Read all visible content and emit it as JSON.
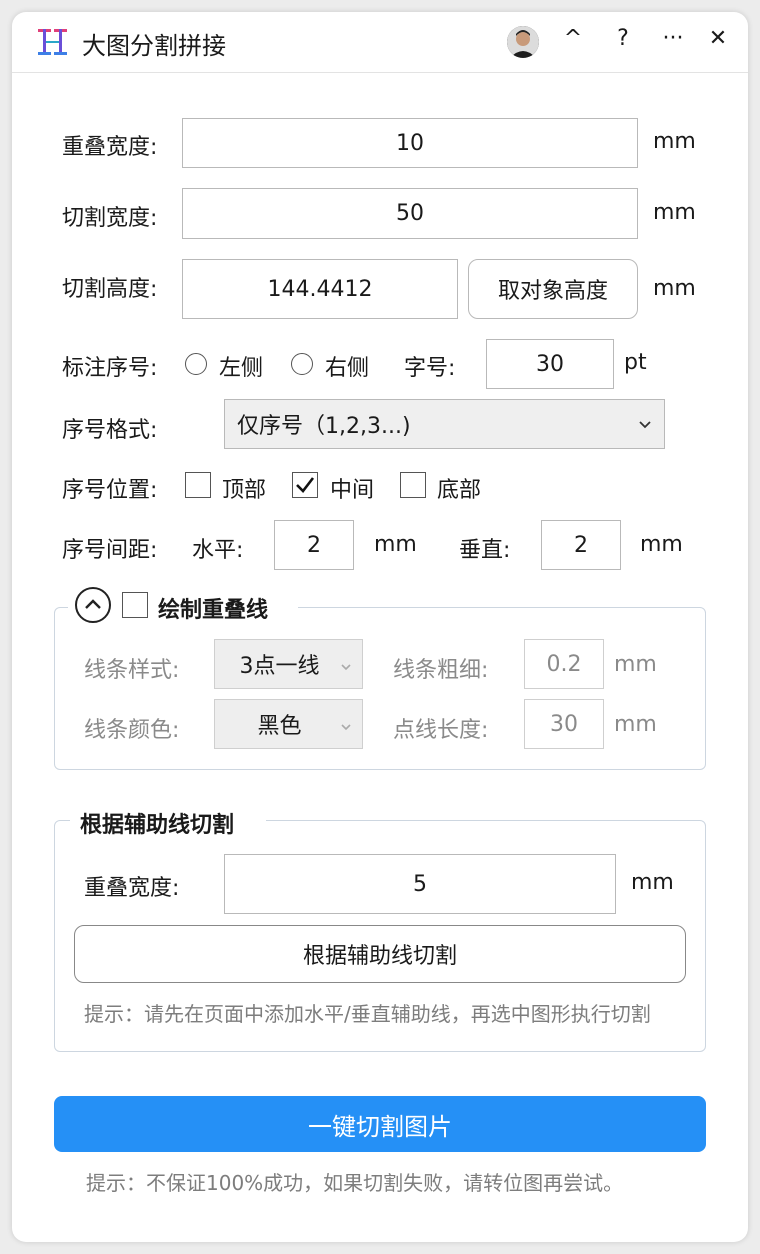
{
  "title": "大图分割拼接",
  "titlebar": {
    "collapse": "^",
    "help": "?",
    "more": "···",
    "close": "✕"
  },
  "overlap": {
    "label": "重叠宽度:",
    "value": "10",
    "unit": "mm"
  },
  "cut_width": {
    "label": "切割宽度:",
    "value": "50",
    "unit": "mm"
  },
  "cut_height": {
    "label": "切割高度:",
    "value": "144.4412",
    "button": "取对象高度",
    "unit": "mm"
  },
  "annot": {
    "label": "标注序号:",
    "left": "左侧",
    "right": "右侧",
    "font_label": "字号:",
    "font_value": "30",
    "font_unit": "pt"
  },
  "format": {
    "label": "序号格式:",
    "value": "仅序号（1,2,3...)"
  },
  "position": {
    "label": "序号位置:",
    "top": "顶部",
    "middle": "中间",
    "bottom": "底部",
    "middle_checked": true
  },
  "spacing": {
    "label": "序号间距:",
    "h_label": "水平:",
    "h_value": "2",
    "h_unit": "mm",
    "v_label": "垂直:",
    "v_value": "2",
    "v_unit": "mm"
  },
  "overlap_line": {
    "title": "绘制重叠线",
    "style_label": "线条样式:",
    "style_value": "3点一线",
    "width_label": "线条粗细:",
    "width_value": "0.2",
    "width_unit": "mm",
    "color_label": "线条颜色:",
    "color_value": "黑色",
    "dash_label": "点线长度:",
    "dash_value": "30",
    "dash_unit": "mm"
  },
  "guide": {
    "title": "根据辅助线切割",
    "overlap_label": "重叠宽度:",
    "overlap_value": "5",
    "overlap_unit": "mm",
    "button": "根据辅助线切割",
    "hint": "提示：请先在页面中添加水平/垂直辅助线，再选中图形执行切割"
  },
  "main_button": "一键切割图片",
  "bottom_hint": "提示：不保证100%成功，如果切割失败，请转位图再尝试。",
  "colors": {
    "primary": "#2590f6",
    "border": "#b9b9b9"
  }
}
